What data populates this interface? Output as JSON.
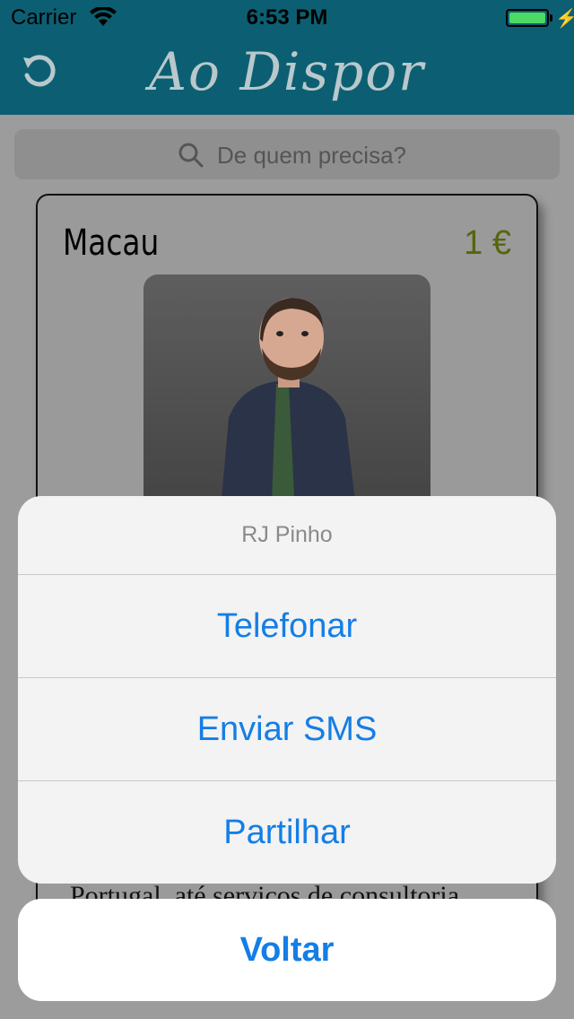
{
  "status_bar": {
    "carrier": "Carrier",
    "time": "6:53 PM",
    "battery_level": 1.0
  },
  "nav": {
    "title": "Ao Dispor",
    "refresh_icon": "refresh-icon"
  },
  "search": {
    "placeholder": "De quem precisa?",
    "icon": "search-icon"
  },
  "card": {
    "title": "Macau",
    "price": "1 €",
    "description_line": "Portugal, até serviços de consultoria"
  },
  "action_sheet": {
    "title": "RJ Pinho",
    "actions": [
      "Telefonar",
      "Enviar SMS",
      "Partilhar"
    ],
    "cancel": "Voltar"
  },
  "colors": {
    "nav_bg": "#0c5f72",
    "accent": "#147ee6",
    "price": "#55660c"
  }
}
